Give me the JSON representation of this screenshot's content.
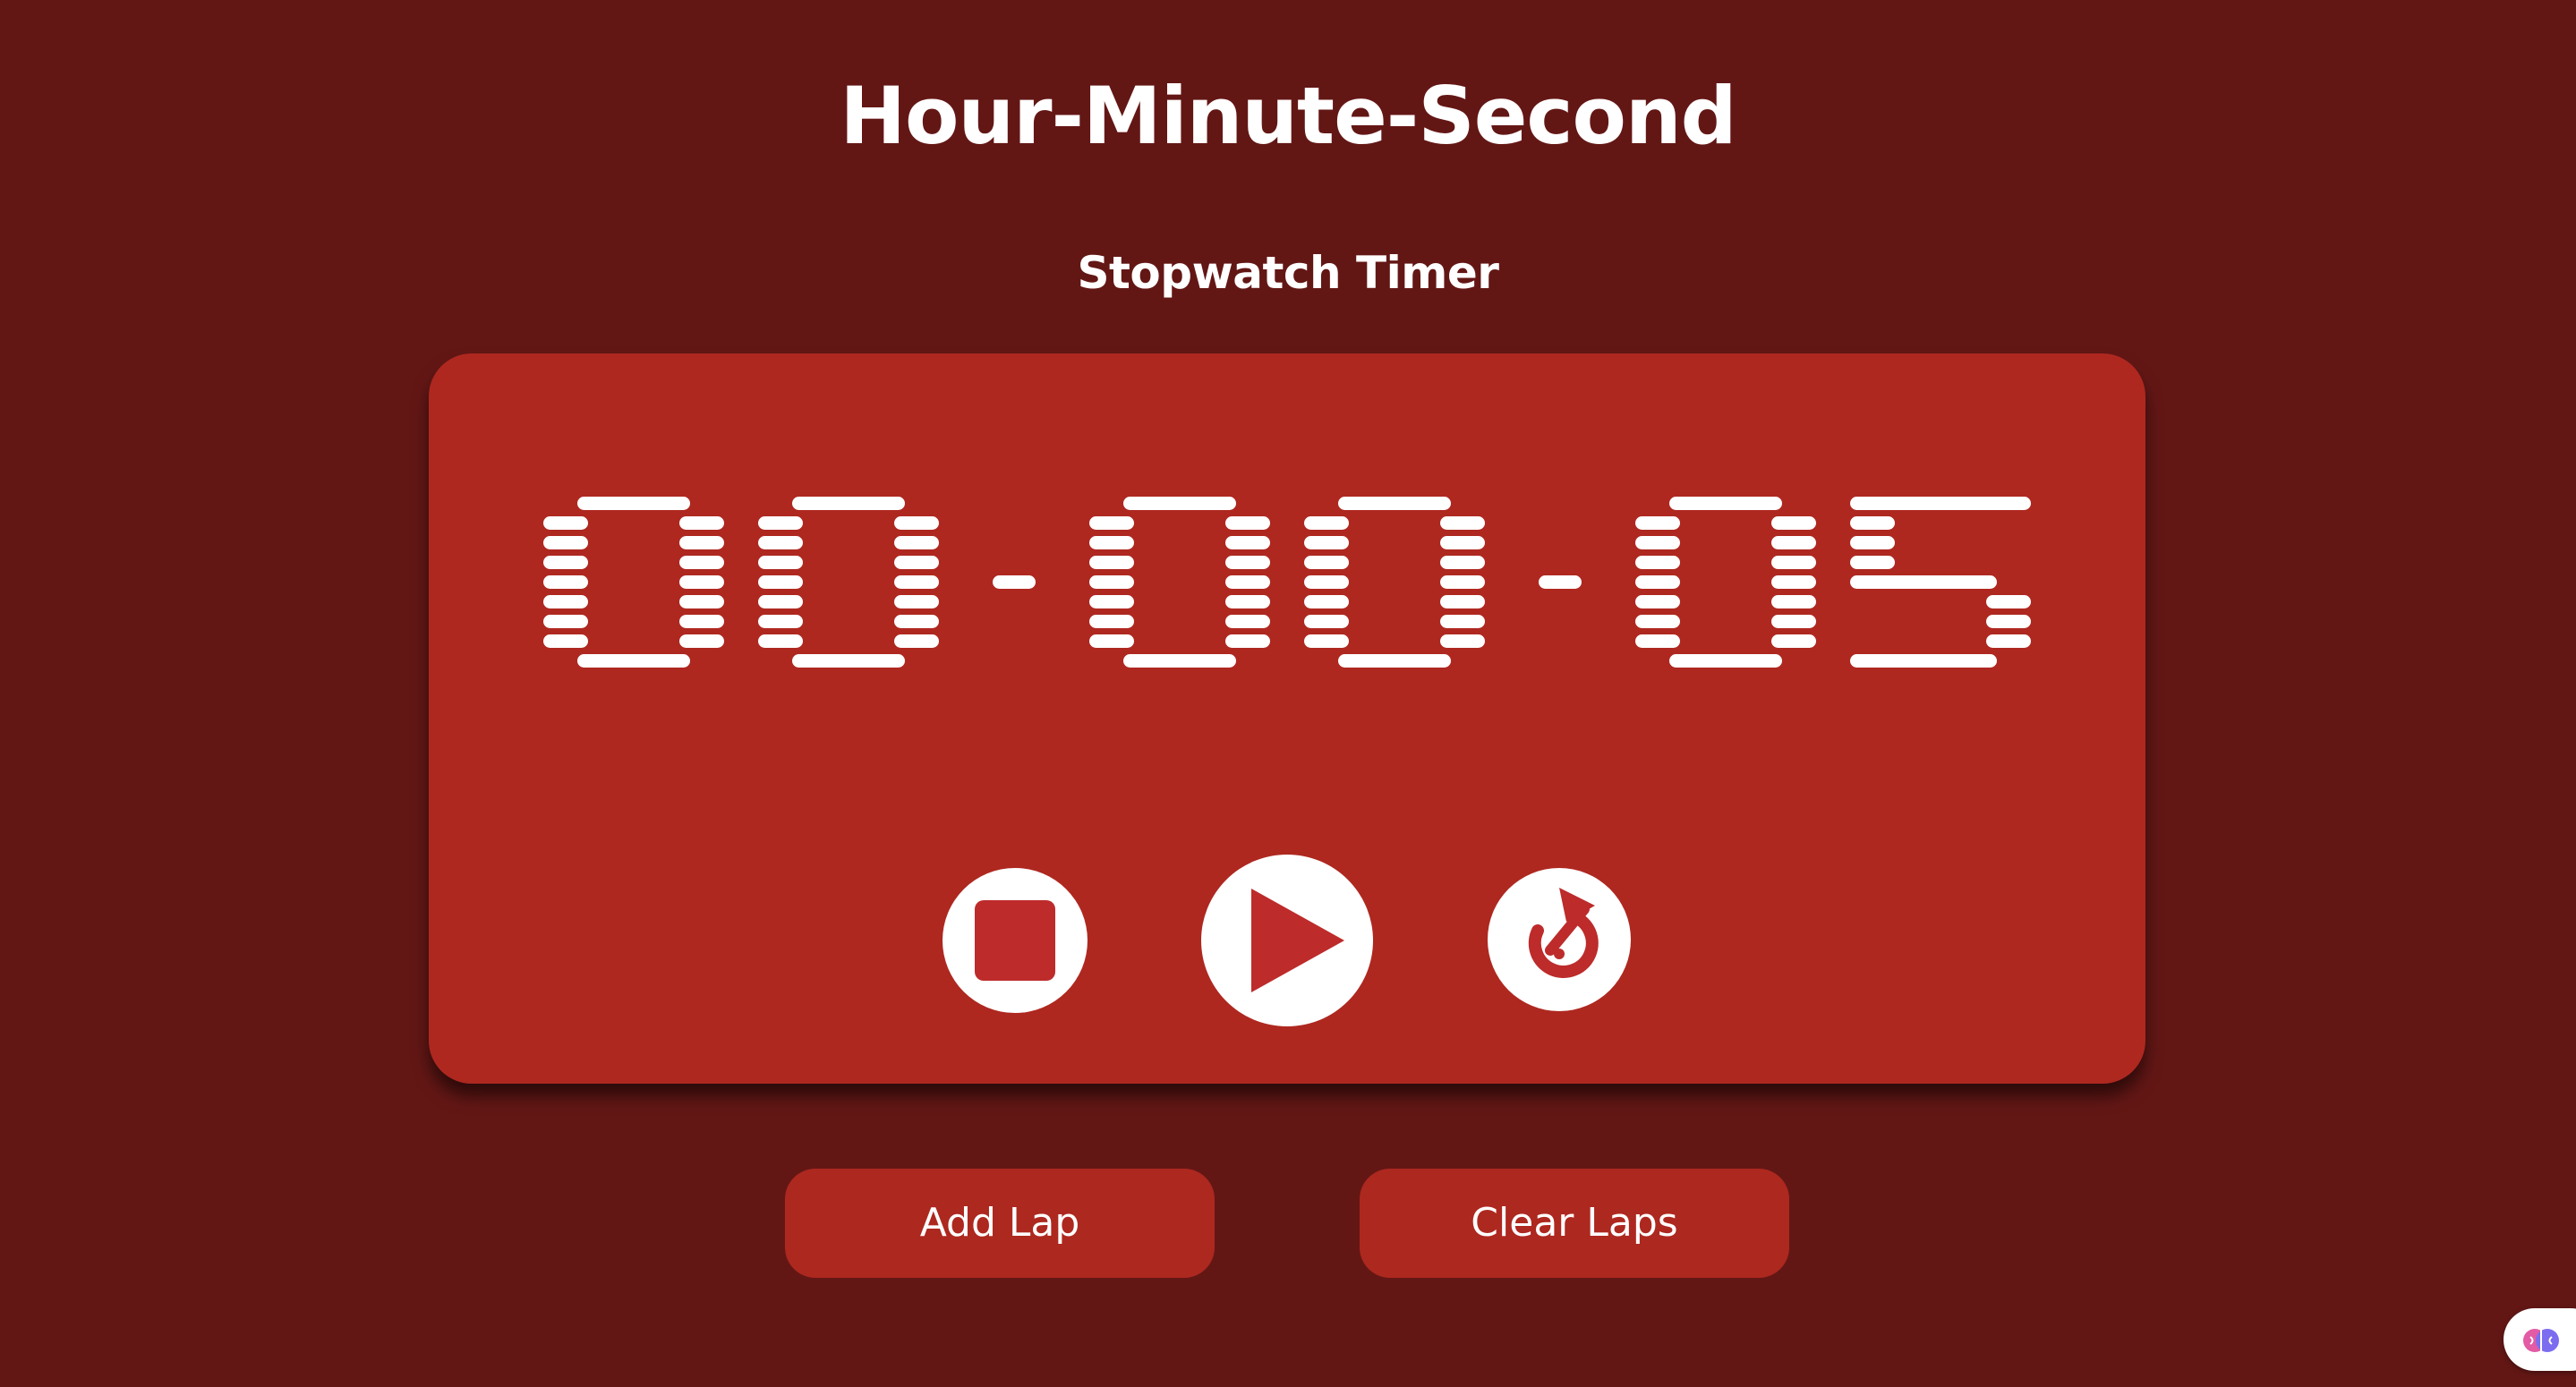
{
  "header": {
    "title": "Hour-Minute-Second",
    "subtitle": "Stopwatch Timer"
  },
  "timer": {
    "hours": "00",
    "minutes": "00",
    "seconds": "05",
    "separator": ":"
  },
  "controls": {
    "stop_icon": "stop-icon",
    "play_icon": "play-icon",
    "reset_icon": "reset-icon"
  },
  "actions": {
    "add_lap_label": "Add Lap",
    "clear_laps_label": "Clear Laps"
  },
  "colors": {
    "background": "#631715",
    "panel": "#ae2820",
    "accent": "#bd2b2b",
    "text": "#ffffff"
  },
  "badge": {
    "icon": "brain-icon"
  }
}
